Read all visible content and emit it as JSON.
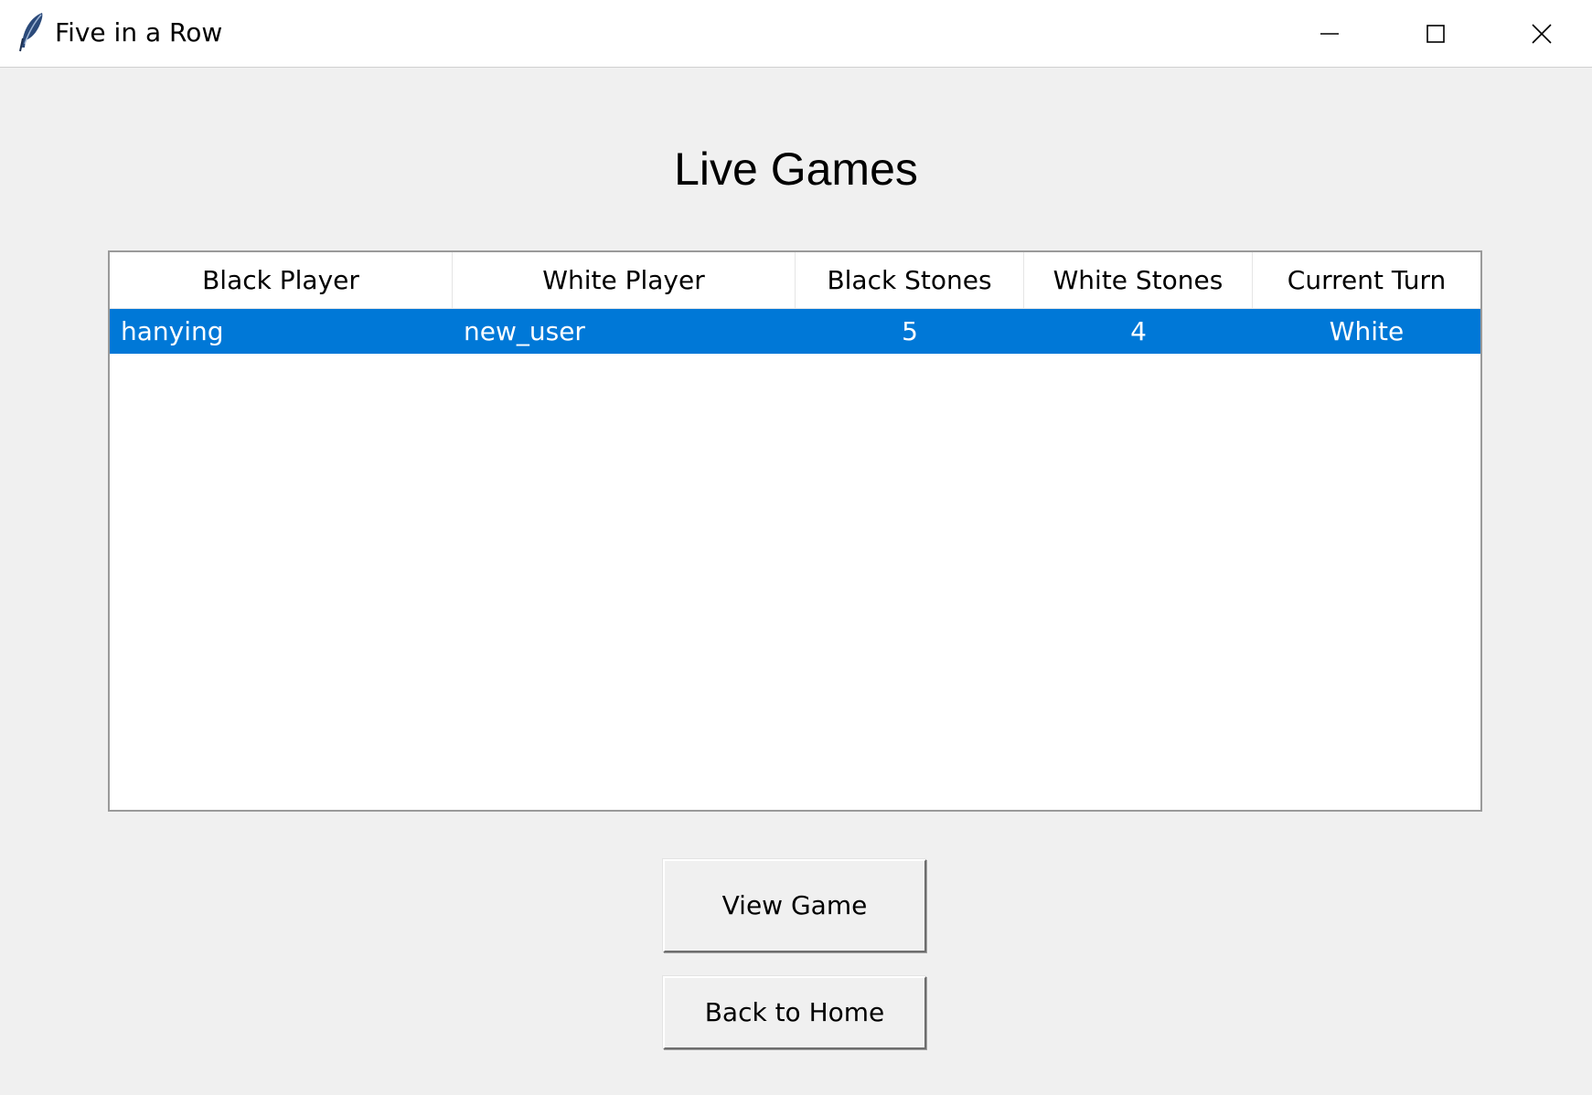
{
  "window": {
    "title": "Five in a Row",
    "icon": "feather-icon",
    "controls": {
      "minimize_icon": "minimize-icon",
      "maximize_icon": "maximize-icon",
      "close_icon": "close-icon"
    }
  },
  "main": {
    "heading": "Live Games",
    "table": {
      "columns": [
        "Black Player",
        "White Player",
        "Black Stones",
        "White Stones",
        "Current Turn"
      ],
      "rows": [
        {
          "black_player": "hanying",
          "white_player": "new_user",
          "black_stones": "5",
          "white_stones": "4",
          "current_turn": "White",
          "selected": true
        }
      ]
    },
    "buttons": {
      "view_game": "View Game",
      "back_home": "Back to Home"
    }
  },
  "colors": {
    "selection": "#0078d7",
    "background": "#f0f0f0",
    "table_background": "#ffffff"
  }
}
